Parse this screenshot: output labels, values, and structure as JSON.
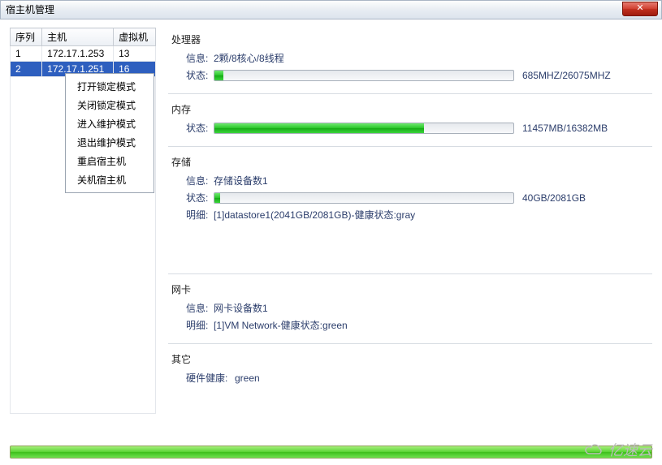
{
  "window": {
    "title": "宿主机管理",
    "close_glyph": "✕"
  },
  "table": {
    "headers": {
      "seq": "序列",
      "host": "主机",
      "vm": "虚拟机"
    },
    "rows": [
      {
        "seq": "1",
        "host": "172.17.1.253",
        "vm": "13"
      },
      {
        "seq": "2",
        "host": "172.17.1.251",
        "vm": "16"
      }
    ]
  },
  "context_menu": {
    "items": [
      "打开锁定模式",
      "关闭锁定模式",
      "进入维护模式",
      "退出维护模式",
      "重启宿主机",
      "关机宿主机"
    ]
  },
  "sections": {
    "cpu": {
      "title": "处理器",
      "info_label": "信息:",
      "info_value": "2颗/8核心/8线程",
      "status_label": "状态:",
      "status_text": "685MHZ/26075MHZ",
      "status_pct": 3
    },
    "mem": {
      "title": "内存",
      "status_label": "状态:",
      "status_text": "11457MB/16382MB",
      "status_pct": 70
    },
    "storage": {
      "title": "存储",
      "info_label": "信息:",
      "info_value": "存储设备数1",
      "status_label": "状态:",
      "status_text": "40GB/2081GB",
      "status_pct": 2,
      "detail_label": "明细:",
      "detail_value": "[1]datastore1(2041GB/2081GB)-健康状态:gray"
    },
    "nic": {
      "title": "网卡",
      "info_label": "信息:",
      "info_value": "网卡设备数1",
      "detail_label": "明细:",
      "detail_value": "[1]VM Network-健康状态:green"
    },
    "other": {
      "title": "其它",
      "health_label": "硬件健康:",
      "health_value": "green"
    }
  },
  "watermark": "亿速云"
}
